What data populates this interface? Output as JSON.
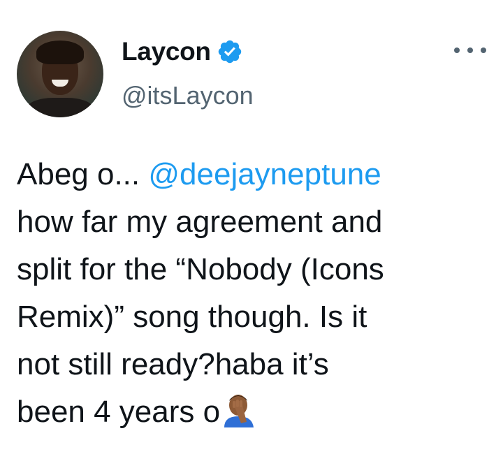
{
  "user": {
    "display_name": "Laycon",
    "handle": "@itsLaycon",
    "verified": true,
    "verified_color": "#1d9bf0"
  },
  "tweet": {
    "line1_prefix": "Abeg o... ",
    "mention": "@deejayneptune",
    "line2": "how far my agreement and",
    "line3": "split for the “Nobody (Icons",
    "line4": "Remix)” song though. Is it",
    "line5": "not still ready?haba it’s",
    "line6": "been 4 years o",
    "emoji": "person-facepalming-icon"
  },
  "colors": {
    "text": "#0f1419",
    "secondary": "#536471",
    "accent": "#1d9bf0"
  }
}
